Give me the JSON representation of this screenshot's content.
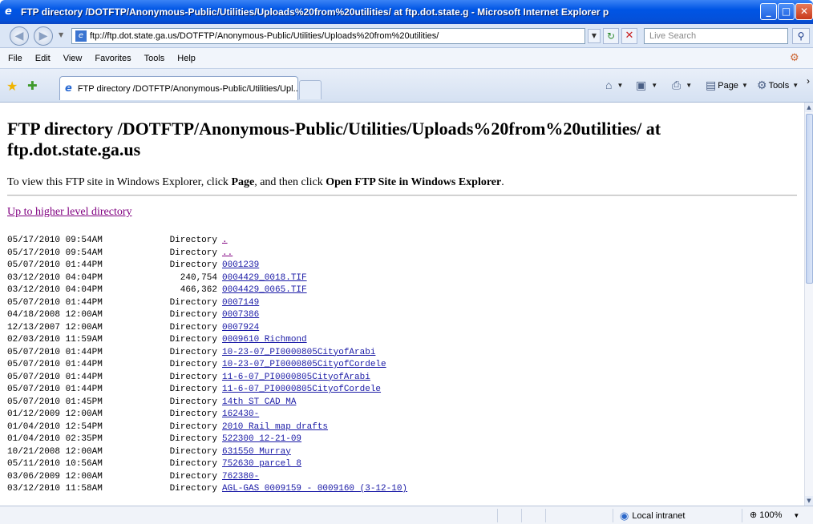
{
  "window": {
    "title": "FTP directory /DOTFTP/Anonymous-Public/Utilities/Uploads%20from%20utilities/ at ftp.dot.state.g - Microsoft Internet Explorer p",
    "app_icon": "ie-icon",
    "min_label": "_",
    "max_label": "□",
    "close_label": "✕"
  },
  "address_bar": {
    "url": "ftp://ftp.dot.state.ga.us/DOTFTP/Anonymous-Public/Utilities/Uploads%20from%20utilities/",
    "search_placeholder": "Live Search"
  },
  "menu": [
    "File",
    "Edit",
    "View",
    "Favorites",
    "Tools",
    "Help"
  ],
  "tab": {
    "label": "FTP directory /DOTFTP/Anonymous-Public/Utilities/Upl..."
  },
  "command_bar": {
    "page_label": "Page",
    "tools_label": "Tools"
  },
  "page": {
    "heading": "FTP directory /DOTFTP/Anonymous-Public/Utilities/Uploads%20from%20utilities/ at ftp.dot.state.ga.us",
    "info_pre": "To view this FTP site in Windows Explorer, click ",
    "info_page": "Page",
    "info_mid": ", and then click ",
    "info_open": "Open FTP Site in Windows Explorer",
    "info_post": ".",
    "up_link": "Up to higher level directory"
  },
  "listing": [
    {
      "date": "05/17/2010 09:54AM",
      "size": "Directory",
      "name": ".",
      "visited": true
    },
    {
      "date": "05/17/2010 09:54AM",
      "size": "Directory",
      "name": "..",
      "visited": true
    },
    {
      "date": "05/07/2010 01:44PM",
      "size": "Directory",
      "name": "0001239",
      "visited": false
    },
    {
      "date": "03/12/2010 04:04PM",
      "size": "240,754",
      "name": "0004429_0018.TIF",
      "visited": false
    },
    {
      "date": "03/12/2010 04:04PM",
      "size": "466,362",
      "name": "0004429_0065.TIF",
      "visited": false
    },
    {
      "date": "05/07/2010 01:44PM",
      "size": "Directory",
      "name": "0007149",
      "visited": false
    },
    {
      "date": "04/18/2008 12:00AM",
      "size": "Directory",
      "name": "0007386",
      "visited": false
    },
    {
      "date": "12/13/2007 12:00AM",
      "size": "Directory",
      "name": "0007924",
      "visited": false
    },
    {
      "date": "02/03/2010 11:59AM",
      "size": "Directory",
      "name": "0009610 Richmond",
      "visited": false
    },
    {
      "date": "05/07/2010 01:44PM",
      "size": "Directory",
      "name": "10-23-07_PI0000805CityofArabi",
      "visited": false
    },
    {
      "date": "05/07/2010 01:44PM",
      "size": "Directory",
      "name": "10-23-07_PI0000805CityofCordele",
      "visited": false
    },
    {
      "date": "05/07/2010 01:44PM",
      "size": "Directory",
      "name": "11-6-07_PI0000805CityofArabi",
      "visited": false
    },
    {
      "date": "05/07/2010 01:44PM",
      "size": "Directory",
      "name": "11-6-07_PI0000805CityofCordele",
      "visited": false
    },
    {
      "date": "05/07/2010 01:45PM",
      "size": "Directory",
      "name": "14th ST CAD MA",
      "visited": false
    },
    {
      "date": "01/12/2009 12:00AM",
      "size": "Directory",
      "name": "162430-",
      "visited": false
    },
    {
      "date": "01/04/2010 12:54PM",
      "size": "Directory",
      "name": "2010 Rail map drafts",
      "visited": false
    },
    {
      "date": "01/04/2010 02:35PM",
      "size": "Directory",
      "name": "522300 12-21-09",
      "visited": false
    },
    {
      "date": "10/21/2008 12:00AM",
      "size": "Directory",
      "name": "631550 Murray",
      "visited": false
    },
    {
      "date": "05/11/2010 10:56AM",
      "size": "Directory",
      "name": "752630 parcel 8",
      "visited": false
    },
    {
      "date": "03/06/2009 12:00AM",
      "size": "Directory",
      "name": "762380-",
      "visited": false
    },
    {
      "date": "03/12/2010 11:58AM",
      "size": "Directory",
      "name": "AGL-GAS 0009159 - 0009160 (3-12-10)",
      "visited": false
    }
  ],
  "status_bar": {
    "zone": "Local intranet",
    "zoom": "100%"
  },
  "colors": {
    "link": "#1a1aa6",
    "visited_link": "#800080",
    "titlebar": "#0055e5"
  }
}
